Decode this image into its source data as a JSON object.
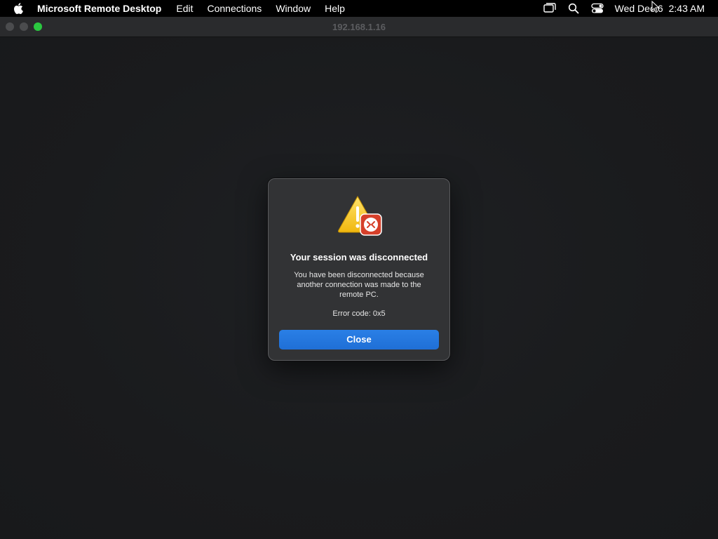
{
  "menubar": {
    "apple_icon": "apple-logo-icon",
    "app_name": "Microsoft Remote Desktop",
    "menus": [
      "Edit",
      "Connections",
      "Window",
      "Help"
    ],
    "status_icons": [
      "screen-mirroring-icon",
      "search-icon",
      "control-center-icon"
    ],
    "date": "Wed Dec 6",
    "time": "2:43 AM"
  },
  "window": {
    "title": "192.168.1.16",
    "traffic_lights": {
      "close_color": "#4b4c4e",
      "minimize_color": "#4b4c4e",
      "zoom_color": "#2bc840"
    }
  },
  "dialog": {
    "icon": "warning-remote-desktop-icon",
    "title": "Your session was disconnected",
    "message": "You have been disconnected because another connection was made to the remote PC.",
    "error": "Error code: 0x5",
    "button_label": "Close",
    "button_color": "#1f6fd6"
  },
  "colors": {
    "menubar": "#000000",
    "titlebar": "#2a2b2d",
    "content": "#1b1c1e",
    "dialog_bg": "#323335",
    "warning_yellow": "#f5c518",
    "rd_badge": "#d6402a"
  }
}
